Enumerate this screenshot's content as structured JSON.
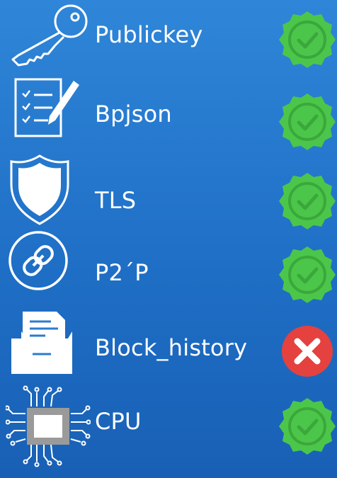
{
  "rows": [
    {
      "id": "publickey",
      "label": "Publickey",
      "icon": "key-icon",
      "status": "ok"
    },
    {
      "id": "bpjson",
      "label": "Bpjson",
      "icon": "document-pen-icon",
      "status": "ok"
    },
    {
      "id": "tls",
      "label": "TLS",
      "icon": "shield-icon",
      "status": "ok"
    },
    {
      "id": "p2p",
      "label": "P2´P",
      "icon": "link-icon",
      "status": "ok"
    },
    {
      "id": "block-history",
      "label": "Block_history",
      "icon": "folder-document-icon",
      "status": "error"
    },
    {
      "id": "cpu",
      "label": "CPU",
      "icon": "cpu-chip-icon",
      "status": "ok"
    }
  ],
  "colors": {
    "ok": "#4cc64a",
    "error": "#e5413f",
    "icon": "#ffffff"
  }
}
